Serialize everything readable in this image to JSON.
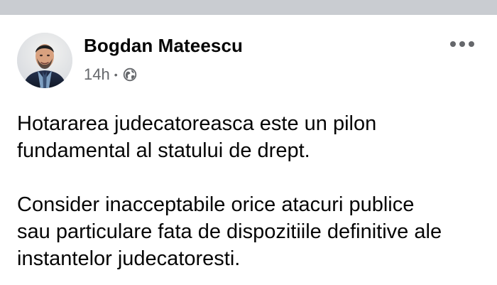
{
  "post": {
    "author_name": "Bogdan Mateescu",
    "timestamp": "14h",
    "separator": "•",
    "privacy_icon": "globe-icon",
    "more_icon": "more-options-icon",
    "paragraphs": [
      "Hotararea judecatoreasca este un pilon\nfundamental al statului de drept.",
      "Consider inacceptabile orice atacuri publice\nsau particulare fata de dispozitiile definitive ale\ninstantelor judecatoresti."
    ]
  },
  "colors": {
    "background": "#ffffff",
    "top_gap": "#c9ccd1",
    "primary_text": "#050505",
    "secondary_text": "#65676b"
  }
}
